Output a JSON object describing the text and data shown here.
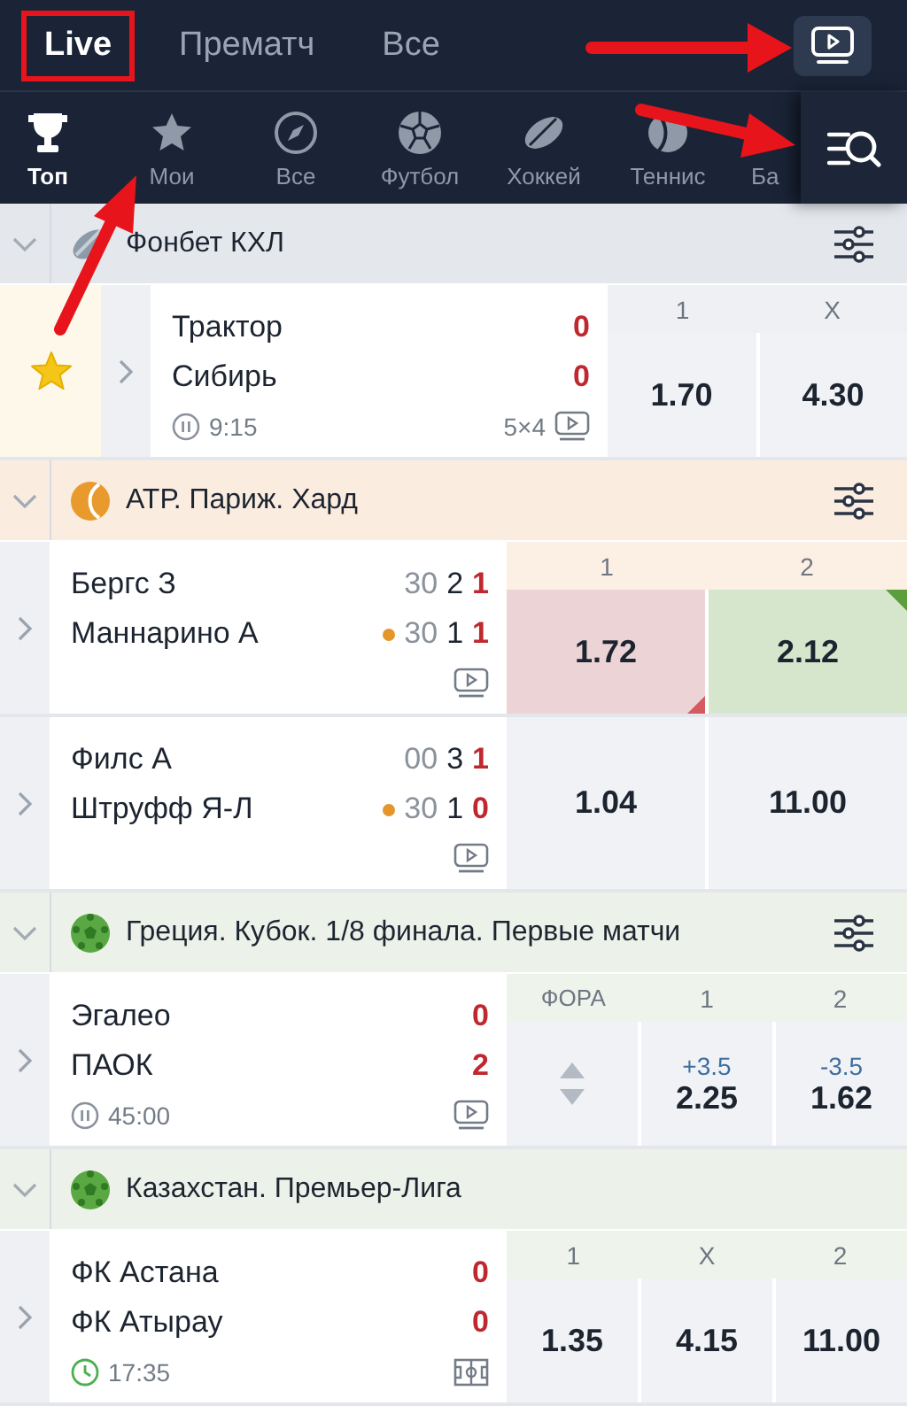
{
  "top_tabs": [
    {
      "label": "Live",
      "selected": true,
      "highlighted": true
    },
    {
      "label": "Прематч",
      "selected": false,
      "highlighted": false
    },
    {
      "label": "Все",
      "selected": false,
      "highlighted": false
    }
  ],
  "sports": [
    {
      "kind": "trophy",
      "label": "Топ",
      "selected": true
    },
    {
      "kind": "star",
      "label": "Мои",
      "selected": false
    },
    {
      "kind": "compass",
      "label": "Все",
      "selected": false
    },
    {
      "kind": "ball",
      "label": "Футбол",
      "selected": false
    },
    {
      "kind": "puck",
      "label": "Хоккей",
      "selected": false
    },
    {
      "kind": "tennis",
      "label": "Теннис",
      "selected": false
    },
    {
      "kind": "partial",
      "label": "Ба",
      "selected": false
    }
  ],
  "leagues": [
    {
      "title": "Фонбет КХЛ",
      "kind": "hockey",
      "expanded": true,
      "columns": [
        "1",
        "X"
      ],
      "matches": [
        {
          "favorite": true,
          "teams": [
            {
              "name": "Трактор",
              "score": [
                "0"
              ],
              "serving": false
            },
            {
              "name": "Сибирь",
              "score": [
                "0"
              ],
              "serving": false
            }
          ],
          "clock": {
            "kind": "pause",
            "time": "9:15"
          },
          "extra": "5×4",
          "media": {
            "kind": "tv"
          },
          "odds": [
            {
              "kind": "odd",
              "value": "1.70"
            },
            {
              "kind": "odd",
              "value": "4.30"
            }
          ]
        }
      ]
    },
    {
      "title": "АТР. Париж. Хард",
      "kind": "tennis",
      "expanded": true,
      "columns": [
        "1",
        "2"
      ],
      "matches": [
        {
          "favorite": false,
          "teams": [
            {
              "name": "Бергс З",
              "score": [
                "30",
                "2",
                "1"
              ],
              "serving": false
            },
            {
              "name": "Маннарино А",
              "score": [
                "30",
                "1",
                "1"
              ],
              "serving": true
            }
          ],
          "media": {
            "kind": "tv"
          },
          "odds": [
            {
              "kind": "odd_down",
              "value": "1.72"
            },
            {
              "kind": "odd_up",
              "value": "2.12"
            }
          ]
        },
        {
          "favorite": false,
          "teams": [
            {
              "name": "Филс А",
              "score": [
                "00",
                "3",
                "1"
              ],
              "serving": false
            },
            {
              "name": "Штруфф Я-Л",
              "score": [
                "30",
                "1",
                "0"
              ],
              "serving": true
            }
          ],
          "media": {
            "kind": "tv"
          },
          "odds": [
            {
              "kind": "odd",
              "value": "1.04"
            },
            {
              "kind": "odd",
              "value": "11.00"
            }
          ]
        }
      ]
    },
    {
      "title": "Греция. Кубок. 1/8 финала. Первые матчи",
      "kind": "football",
      "expanded": true,
      "columns": [
        "ФОРА",
        "1",
        "2"
      ],
      "matches": [
        {
          "favorite": false,
          "teams": [
            {
              "name": "Эгалео",
              "score": [
                "0"
              ],
              "serving": false
            },
            {
              "name": "ПАОК",
              "score": [
                "2"
              ],
              "serving": false
            }
          ],
          "clock": {
            "kind": "pause",
            "time": "45:00"
          },
          "media": {
            "kind": "tv"
          },
          "odds": [
            {
              "kind": "stepper"
            },
            {
              "kind": "odd",
              "handicap": "+3.5",
              "value": "2.25"
            },
            {
              "kind": "odd",
              "handicap": "-3.5",
              "value": "1.62"
            }
          ]
        }
      ]
    },
    {
      "title": "Казахстан. Премьер-Лига",
      "kind": "football",
      "expanded": true,
      "columns": [
        "1",
        "X",
        "2"
      ],
      "matches": [
        {
          "favorite": false,
          "teams": [
            {
              "name": "ФК Астана",
              "score": [
                "0"
              ],
              "serving": false
            },
            {
              "name": "ФК Атырау",
              "score": [
                "0"
              ],
              "serving": false
            }
          ],
          "clock": {
            "kind": "clock",
            "time": "17:35"
          },
          "media": {
            "kind": "field"
          },
          "odds": [
            {
              "kind": "odd",
              "value": "1.35"
            },
            {
              "kind": "odd",
              "value": "4.15"
            },
            {
              "kind": "odd",
              "value": "11.00"
            }
          ]
        }
      ]
    }
  ]
}
